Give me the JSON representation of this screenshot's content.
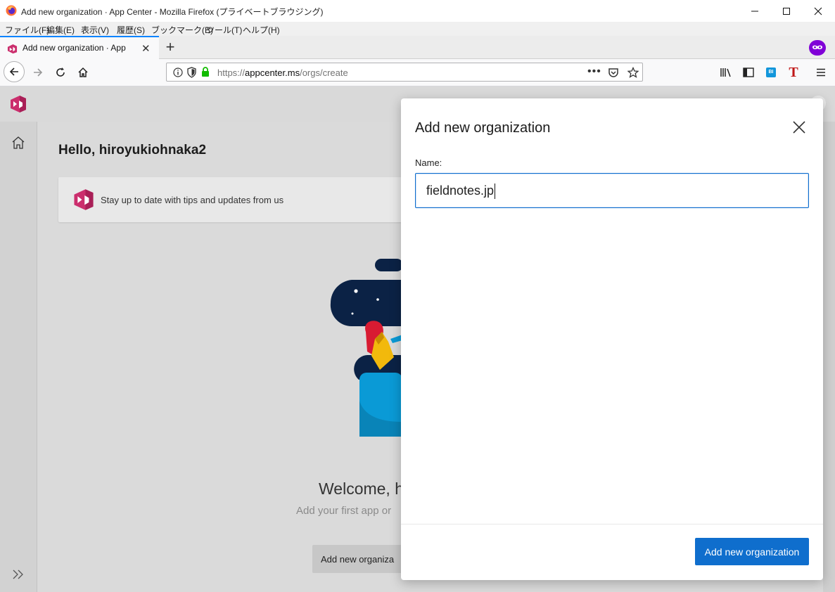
{
  "window": {
    "title": "Add new organization · App Center - Mozilla Firefox (プライベートブラウジング)"
  },
  "menu": {
    "items": [
      "ファイル(F)",
      "編集(E)",
      "表示(V)",
      "履歴(S)",
      "ブックマーク(B)",
      "ツール(T)",
      "ヘルプ(H)"
    ]
  },
  "tab": {
    "label": "Add new organization · App Center"
  },
  "urlbar": {
    "prefix": "https://",
    "host": "appcenter.ms",
    "path": "/orgs/create"
  },
  "page": {
    "greeting": "Hello, hiroyukiohnaka2",
    "tip": "Stay up to date with tips and updates from us",
    "welcome": "Welcome, h",
    "subwelcome": "Add your first app or",
    "add_org_button": "Add new organiza"
  },
  "dialog": {
    "title": "Add new organization",
    "name_label": "Name:",
    "name_value": "fieldnotes.jp",
    "submit_label": "Add new organization"
  },
  "colors": {
    "accent": "#0f6ecd",
    "app_brand": "#cb2e6d",
    "private_badge": "#8000d7",
    "illustration_navy": "#0b2245",
    "illustration_blue": "#0a9ad6"
  }
}
